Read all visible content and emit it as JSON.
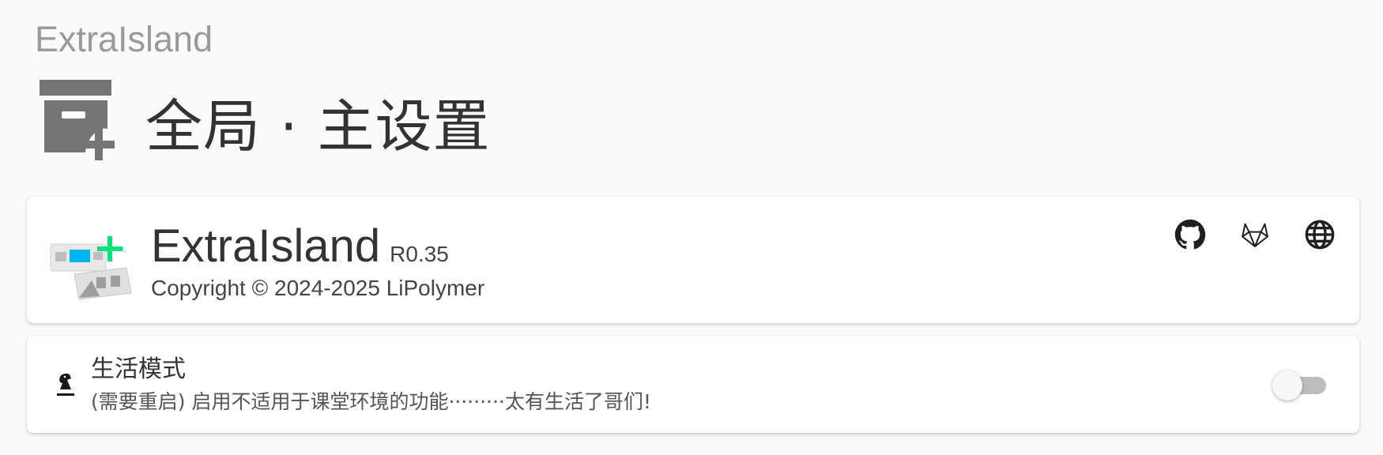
{
  "app": {
    "name": "ExtraIsland"
  },
  "header": {
    "icon": "archive-plus-icon",
    "title": "全局 · 主设置"
  },
  "about": {
    "logo_icon": "extraisland-logo-icon",
    "name": "ExtraIsland",
    "version": "R0.35",
    "copyright": "Copyright © 2024-2025 LiPolymer",
    "links": [
      {
        "icon": "github-icon"
      },
      {
        "icon": "gitlab-icon"
      },
      {
        "icon": "globe-icon"
      }
    ]
  },
  "life_mode": {
    "icon": "chess-knight-icon",
    "title": "生活模式",
    "description": "(需要重启) 启用不适用于课堂环境的功能·········太有生活了哥们!",
    "enabled": false
  },
  "colors": {
    "accent_cyan": "#00b4f0",
    "accent_green": "#00e676",
    "icon_gray": "#757575",
    "toggle_track": "#bdbdbd"
  }
}
